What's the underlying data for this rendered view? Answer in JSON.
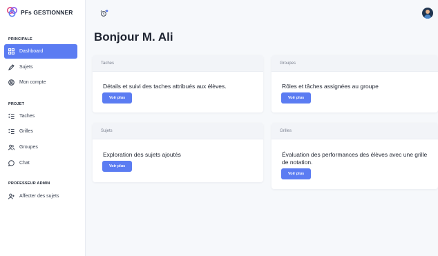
{
  "brand": {
    "name": "PFs GESTIONNER"
  },
  "sidebar": {
    "sections": [
      {
        "title": "PRINCIPALE"
      },
      {
        "title": "PROJET"
      },
      {
        "title": "PROFESSEUR ADMIN"
      }
    ],
    "items": [
      {
        "label": "Dashboard",
        "icon": "grid-icon",
        "active": true
      },
      {
        "label": "Sujets",
        "icon": "pen-icon"
      },
      {
        "label": "Mon compte",
        "icon": "account-icon"
      },
      {
        "label": "Taches",
        "icon": "list-check-icon"
      },
      {
        "label": "Grilles",
        "icon": "list-check-icon"
      },
      {
        "label": "Groupes",
        "icon": "group-icon"
      },
      {
        "label": "Chat",
        "icon": "chat-icon"
      },
      {
        "label": "Affecter des sujets",
        "icon": "user-add-icon"
      }
    ]
  },
  "header": {
    "greeting": "Bonjour M. Ali"
  },
  "cards": [
    {
      "title": "Taches",
      "text": "Détails et suivi des taches attribués aux élèves.",
      "button": "Voir plus"
    },
    {
      "title": "Groupes",
      "text": "Rôles et tâches assignées au groupe",
      "button": "Voir plus"
    },
    {
      "title": "Sujets",
      "text": "Exploration des sujets ajoutés",
      "button": "Voir plus"
    },
    {
      "title": "Grilles",
      "text": "Évaluation des performances des élèves avec une grille de notation.",
      "button": "Voir plus"
    }
  ],
  "colors": {
    "accent": "#5b7cf2",
    "background": "#f6f8fb",
    "sidebar": "#ffffff"
  }
}
